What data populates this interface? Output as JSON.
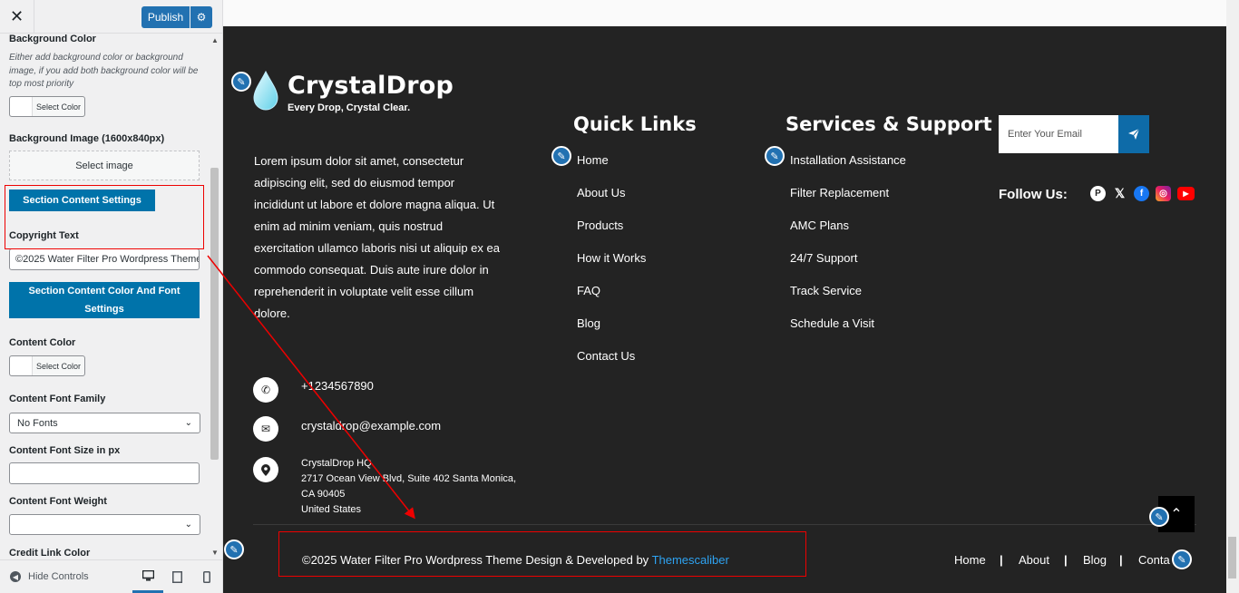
{
  "panel": {
    "close_label": "✕",
    "publish_label": "Publish",
    "gear_label": "⚙",
    "bg_color_label": "Background Color",
    "bg_color_desc": "Either add background color or background image, if you add both background color will be top most priority",
    "select_color": "Select Color",
    "bg_image_label": "Background Image (1600x840px)",
    "select_image": "Select image",
    "section_content_settings": "Section Content Settings",
    "copyright_label": "Copyright Text",
    "copyright_value": "©2025 Water Filter Pro Wordpress Theme Design & Developed by Themescaliber",
    "section_color_font": "Section Content Color And Font Settings",
    "content_color_label": "Content Color",
    "font_family_label": "Content Font Family",
    "font_family_value": "No Fonts",
    "font_size_label": "Content Font Size in px",
    "font_size_value": "",
    "font_weight_label": "Content Font Weight",
    "font_weight_value": "",
    "credit_color_label": "Credit Link Color",
    "hide_controls": "Hide Controls"
  },
  "footer": {
    "brand": "CrystalDrop",
    "tagline": "Every Drop, Crystal Clear.",
    "about": "Lorem ipsum dolor sit amet, consectetur adipiscing elit, sed do eiusmod tempor incididunt ut labore et dolore magna aliqua. Ut enim ad minim veniam, quis nostrud exercitation ullamco laboris nisi ut aliquip ex ea commodo consequat. Duis aute irure dolor in reprehenderit in voluptate velit esse cillum dolore.",
    "phone": "+1234567890",
    "email": "crystaldrop@example.com",
    "address": [
      "CrystalDrop HQ",
      "2717 Ocean View Blvd, Suite 402 Santa Monica,",
      "CA 90405",
      "United States"
    ],
    "quick_links_title": "Quick Links",
    "quick_links": [
      "Home",
      "About Us",
      "Products",
      "How it Works",
      "FAQ",
      "Blog",
      "Contact Us"
    ],
    "services_title": "Services & Support",
    "services": [
      "Installation Assistance",
      "Filter Replacement",
      "AMC Plans",
      "24/7 Support",
      "Track Service",
      "Schedule a Visit"
    ],
    "email_placeholder": "Enter Your Email",
    "follow_us": "Follow Us:",
    "copyright_text": "©2025 Water Filter Pro Wordpress Theme Design & Developed by ",
    "copyright_link": "Themescaliber",
    "bottom_links": [
      "Home",
      "About",
      "Blog",
      "Conta"
    ]
  },
  "colors": {
    "accent": "#2271b1",
    "section_blue": "#0073aa",
    "footer_bg": "#232323",
    "highlight_red": "#e00000",
    "link_blue": "#2ea3f2"
  }
}
